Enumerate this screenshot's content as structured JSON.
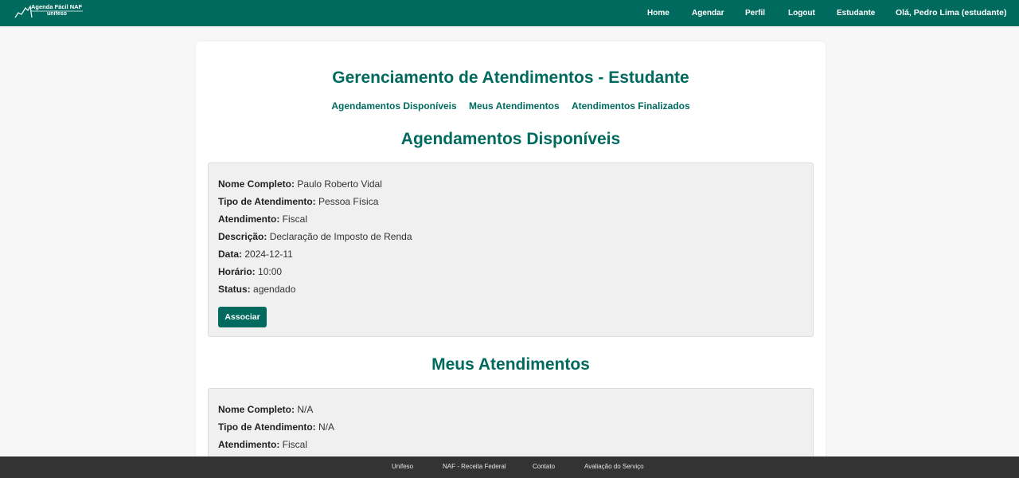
{
  "header": {
    "brand": {
      "title": "Agenda Fácil NAF",
      "subtitle": "unifeso"
    },
    "nav": [
      {
        "label": "Home"
      },
      {
        "label": "Agendar"
      },
      {
        "label": "Perfil"
      },
      {
        "label": "Logout"
      },
      {
        "label": "Estudante"
      }
    ],
    "greeting": "Olá, Pedro Lima (estudante)"
  },
  "main": {
    "title": "Gerenciamento de Atendimentos - Estudante",
    "subnav": [
      "Agendamentos Disponíveis",
      "Meus Atendimentos",
      "Atendimentos Finalizados"
    ],
    "available": {
      "heading": "Agendamentos Disponíveis",
      "entry": {
        "fields": [
          {
            "label": "Nome Completo:",
            "value": "Paulo Roberto Vidal"
          },
          {
            "label": "Tipo de Atendimento:",
            "value": "Pessoa Física"
          },
          {
            "label": "Atendimento:",
            "value": "Fiscal"
          },
          {
            "label": "Descrição:",
            "value": "Declaração de Imposto de Renda"
          },
          {
            "label": "Data:",
            "value": "2024-12-11"
          },
          {
            "label": "Horário:",
            "value": "10:00"
          },
          {
            "label": "Status:",
            "value": "agendado"
          }
        ],
        "action": "Associar"
      }
    },
    "mine": {
      "heading": "Meus Atendimentos",
      "entry": {
        "fields": [
          {
            "label": "Nome Completo:",
            "value": "N/A"
          },
          {
            "label": "Tipo de Atendimento:",
            "value": "N/A"
          },
          {
            "label": "Atendimento:",
            "value": "Fiscal"
          }
        ]
      }
    }
  },
  "footer": {
    "links": [
      "Unifeso",
      "NAF - Receita Federal",
      "Contato",
      "Avaliação do Serviço"
    ]
  },
  "colors": {
    "primary": "#006a5f",
    "footer": "#333333",
    "entry_bg": "#f0f0f0",
    "page_bg": "#f7f7f7"
  }
}
